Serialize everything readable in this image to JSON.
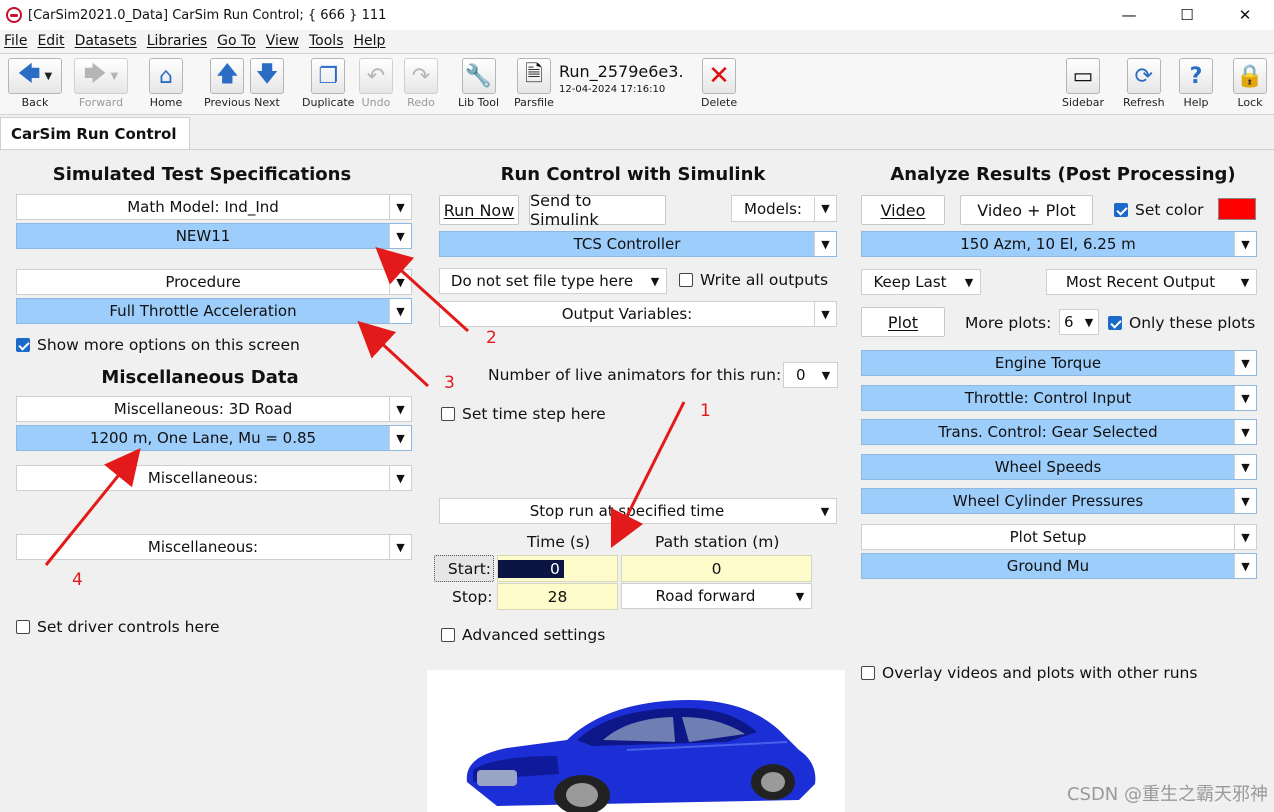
{
  "window": {
    "title": "[CarSim2021.0_Data] CarSim Run Control; { 666 } 111",
    "controls": [
      "—",
      "☐",
      "✕"
    ]
  },
  "menu": [
    "File",
    "Edit",
    "Datasets",
    "Libraries",
    "Go To",
    "View",
    "Tools",
    "Help"
  ],
  "toolbar": {
    "back": "Back",
    "forward": "Forward",
    "home": "Home",
    "previous": "Previous",
    "next": "Next",
    "duplicate": "Duplicate",
    "undo": "Undo",
    "redo": "Redo",
    "lib_tool": "Lib Tool",
    "parsfile": "Parsfile",
    "run_title": "Run_2579e6e3.",
    "run_date": "12-04-2024 17:16:10",
    "delete": "Delete",
    "sidebar": "Sidebar",
    "refresh": "Refresh",
    "help": "Help",
    "lock": "Lock"
  },
  "tab": "CarSim Run Control",
  "left": {
    "heading": "Simulated Test Specifications",
    "math_model": "Math Model: Ind_Ind",
    "math_model_value": "NEW11",
    "procedure": "Procedure",
    "procedure_value": "Full Throttle Acceleration",
    "show_more": "Show more options on this screen",
    "misc_heading": "Miscellaneous Data",
    "misc1": "Miscellaneous: 3D Road",
    "misc1_value": "1200 m, One Lane, Mu = 0.85",
    "misc2": "Miscellaneous:",
    "misc3": "Miscellaneous:",
    "driver_controls": "Set driver controls here"
  },
  "center": {
    "heading": "Run Control with Simulink",
    "run_now": "Run Now",
    "send_to_simulink": "Send to Simulink",
    "models": "Models:",
    "model_value": "TCS Controller",
    "file_type": "Do not set file type here",
    "write_all": "Write all outputs",
    "output_vars": "Output Variables:",
    "live_animators_label": "Number of live animators for this run:",
    "live_animators_value": "0",
    "set_time_step": "Set time step here",
    "stop_run": "Stop run at specified time",
    "time_header": "Time (s)",
    "path_header": "Path station (m)",
    "start_label": "Start:",
    "start_time": "0",
    "start_station": "0",
    "stop_label": "Stop:",
    "stop_time": "28",
    "stop_station": "Road forward",
    "advanced": "Advanced settings"
  },
  "right": {
    "heading": "Analyze Results (Post Processing)",
    "video": "Video",
    "video_plot": "Video + Plot",
    "set_color": "Set color",
    "color_swatch": "#ff0000",
    "camera": "150 Azm, 10 El, 6.25 m",
    "keep_last": "Keep Last",
    "most_recent": "Most Recent Output",
    "plot": "Plot",
    "more_plots_label": "More plots:",
    "more_plots_value": "6",
    "only_these": "Only these plots",
    "plots": [
      "Engine Torque",
      "Throttle: Control Input",
      "Trans. Control: Gear Selected",
      "Wheel Speeds",
      "Wheel Cylinder Pressures"
    ],
    "plot_setup": "Plot Setup",
    "ground_mu": "Ground Mu",
    "overlay": "Overlay videos and plots with other runs"
  },
  "annotations": [
    "1",
    "2",
    "3",
    "4"
  ],
  "watermark": "CSDN @重生之霸天邪神",
  "colors": {
    "selection_blue": "#9dcdfb",
    "input_yellow": "#fffccb",
    "annotation_red": "#e31a1a"
  }
}
